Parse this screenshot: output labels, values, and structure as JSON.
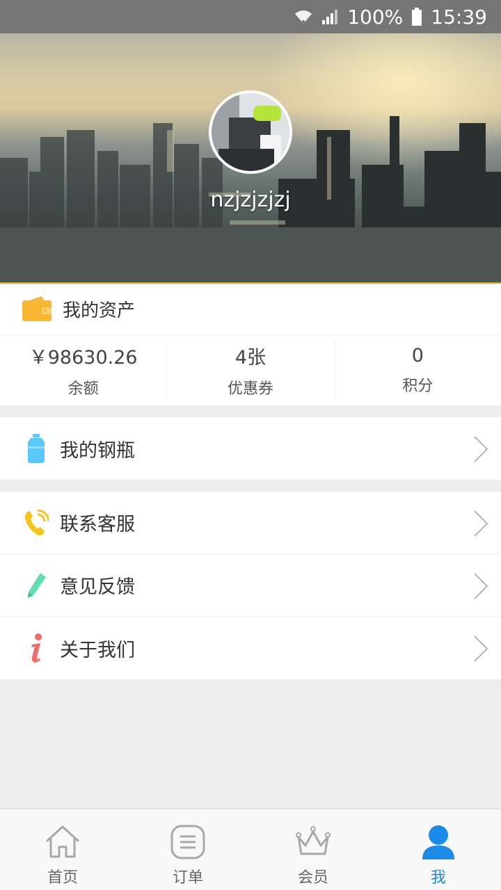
{
  "status_bar": {
    "battery": "100%",
    "time": "15:39"
  },
  "profile": {
    "username": "nzjzjzjzj"
  },
  "assets": {
    "title": "我的资产",
    "items": [
      {
        "value": "￥98630.26",
        "label": "余额"
      },
      {
        "value": "4张",
        "label": "优惠券"
      },
      {
        "value": "0",
        "label": "积分"
      }
    ]
  },
  "menu": {
    "cylinder": "我的钢瓶",
    "contact": "联系客服",
    "feedback": "意见反馈",
    "about": "关于我们"
  },
  "tabbar": {
    "home": "首页",
    "orders": "订单",
    "member": "会员",
    "me": "我",
    "active": "me"
  },
  "colors": {
    "accent": "#1a8ce8",
    "wallet": "#f7b733",
    "cylinder": "#5ac8fa",
    "phone": "#f5c518",
    "pen": "#5ee0b0",
    "info": "#f06a6a"
  }
}
